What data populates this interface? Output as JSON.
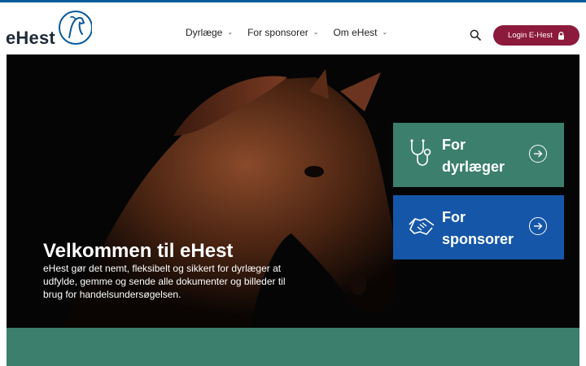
{
  "brand": {
    "name": "eHest"
  },
  "nav": {
    "items": [
      {
        "label": "Dyrlæge"
      },
      {
        "label": "For sponsorer"
      },
      {
        "label": "Om eHest"
      }
    ]
  },
  "header": {
    "login_label": "Login E-Hest"
  },
  "hero": {
    "title": "Velkommen til eHest",
    "description": "eHest gør det nemt, fleksibelt og sikkert for dyrlæger at udfylde, gemme og sende alle dokumenter og billeder til brug for handelsundersøgelsen."
  },
  "cards": [
    {
      "line1": "For",
      "line2": "dyrlæger",
      "color": "#3b7f6c",
      "icon": "stethoscope-icon"
    },
    {
      "line1": "For",
      "line2": "sponsorer",
      "color": "#1556a8",
      "icon": "handshake-icon"
    }
  ],
  "colors": {
    "accent_blue": "#0a5a9c",
    "login": "#8c1a3c",
    "teal": "#3b7f6c",
    "blue": "#1556a8"
  }
}
